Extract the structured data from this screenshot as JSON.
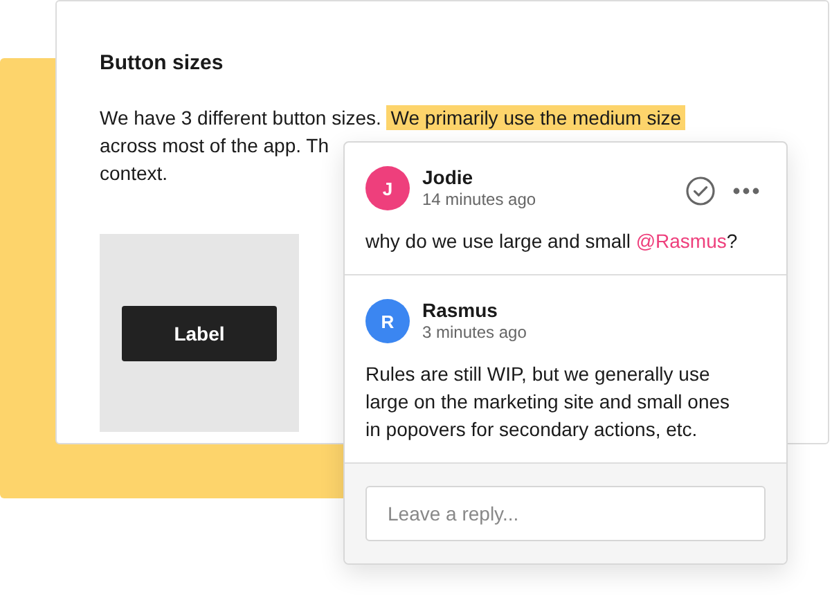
{
  "document": {
    "title": "Button sizes",
    "paragraph_lines": [
      [
        {
          "text": "We have 3 different button sizes. ",
          "highlighted": false
        },
        {
          "text": "We primarily use the medium size",
          "highlighted": true
        }
      ],
      [
        {
          "text": "across most of the app. Th",
          "highlighted": false
        }
      ],
      [
        {
          "text": "context.",
          "highlighted": false
        }
      ]
    ],
    "example_button": {
      "label": "Label"
    }
  },
  "comments": [
    {
      "initial": "J",
      "color": "#ee3f7c",
      "author": "Jodie",
      "time": "14 minutes ago",
      "actions": true,
      "segments": [
        {
          "kind": "text",
          "text": "why do we use large and small "
        },
        {
          "kind": "mention",
          "text": "@Rasmus"
        },
        {
          "kind": "text",
          "text": "?"
        }
      ]
    },
    {
      "initial": "R",
      "color": "#3b86f1",
      "author": "Rasmus",
      "time": "3 minutes ago",
      "actions": false,
      "segments": [
        {
          "kind": "text",
          "text": "Rules are still WIP, but we generally use large on the marketing site and small ones in popovers for secondary actions, etc."
        }
      ]
    }
  ],
  "reply": {
    "placeholder": "Leave a reply..."
  }
}
